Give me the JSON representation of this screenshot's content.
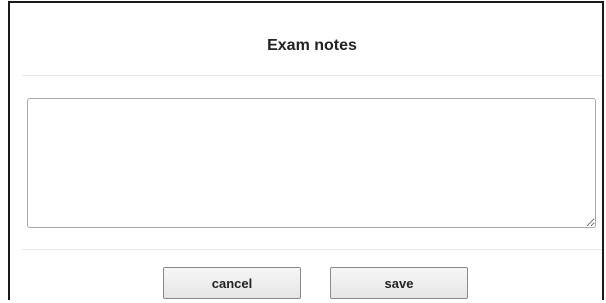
{
  "dialog": {
    "title": "Exam notes",
    "notes_value": "",
    "cancel_label": "cancel",
    "save_label": "save"
  }
}
